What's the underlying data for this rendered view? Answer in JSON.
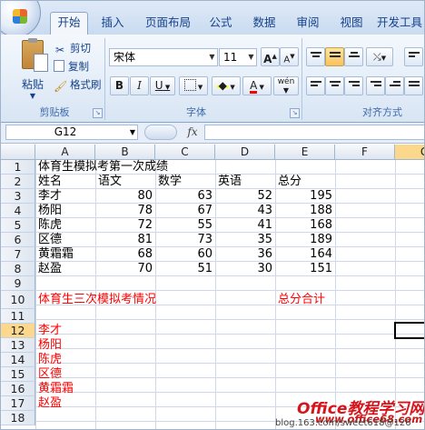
{
  "ribbon": {
    "tabs": [
      "开始",
      "插入",
      "页面布局",
      "公式",
      "数据",
      "审阅",
      "视图",
      "开发工具"
    ],
    "active_tab": "开始",
    "clipboard": {
      "paste_label": "粘贴",
      "cut_label": "剪切",
      "copy_label": "复制",
      "format_painter_label": "格式刷",
      "group_label": "剪贴板"
    },
    "font": {
      "font_name": "宋体",
      "font_size": "11",
      "grow": "A",
      "shrink": "A",
      "bold": "B",
      "italic": "I",
      "underline": "U",
      "font_color_glyph": "A",
      "phonetic_glyph": "wén",
      "group_label": "字体"
    },
    "alignment": {
      "group_label": "对齐方式"
    }
  },
  "formula_bar": {
    "name_box": "G12",
    "fx": "fx",
    "formula": ""
  },
  "grid": {
    "columns": [
      "A",
      "B",
      "C",
      "D",
      "E",
      "F",
      "G"
    ],
    "rows": [
      "1",
      "2",
      "3",
      "4",
      "5",
      "6",
      "7",
      "8",
      "9",
      "10",
      "11",
      "12",
      "13",
      "14",
      "15",
      "16",
      "17",
      "18"
    ],
    "title": "体育生模拟考第一次成绩",
    "headers": [
      "姓名",
      "语文",
      "数学",
      "英语",
      "总分"
    ],
    "records": [
      {
        "name": "李才",
        "chinese": "80",
        "math": "63",
        "english": "52",
        "total": "195"
      },
      {
        "name": "杨阳",
        "chinese": "78",
        "math": "67",
        "english": "43",
        "total": "188"
      },
      {
        "name": "陈虎",
        "chinese": "72",
        "math": "55",
        "english": "41",
        "total": "168"
      },
      {
        "name": "区德",
        "chinese": "81",
        "math": "73",
        "english": "35",
        "total": "189"
      },
      {
        "name": "黄霜霜",
        "chinese": "68",
        "math": "60",
        "english": "36",
        "total": "164"
      },
      {
        "name": "赵盈",
        "chinese": "70",
        "math": "51",
        "english": "30",
        "total": "151"
      }
    ],
    "summary_title": "体育生三次模拟考情况",
    "summary_total_label": "总分合计",
    "name_list": [
      "李才",
      "杨阳",
      "陈虎",
      "区德",
      "黄霜霜",
      "赵盈"
    ]
  },
  "watermark": {
    "brand": "Office教程学习网",
    "url": "www.office68.com",
    "source": "blog.163.com/sweet618@126"
  },
  "colors": {
    "accent": "#15428b",
    "red_text": "#ff0000",
    "selection": "#fbd88c"
  }
}
